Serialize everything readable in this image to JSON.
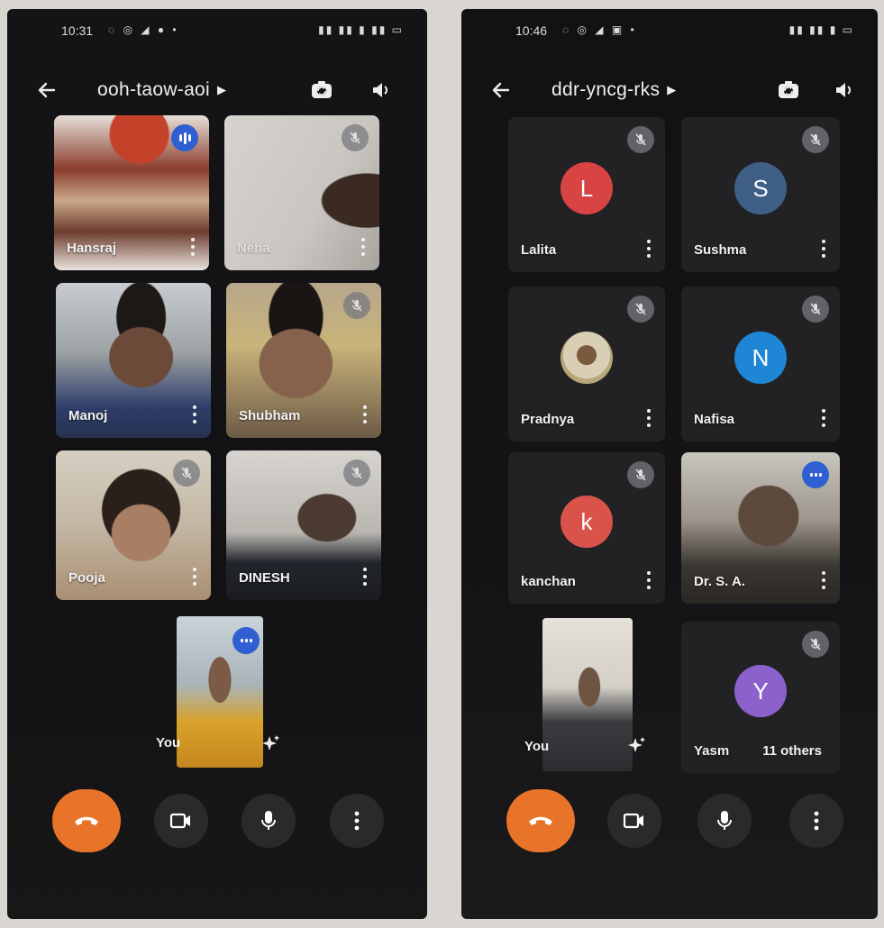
{
  "colors": {
    "end_call": "#e8742a",
    "talk_badge": "#2f5fd0"
  },
  "left_call": {
    "status_time": "10:31",
    "meeting_code": "ooh-taow-aoi",
    "participants": [
      {
        "name": "Hansraj"
      },
      {
        "name": "Neha"
      },
      {
        "name": "Manoj"
      },
      {
        "name": "Shubham"
      },
      {
        "name": "Pooja"
      },
      {
        "name": "DINESH"
      }
    ],
    "self_label": "You"
  },
  "right_call": {
    "status_time": "10:46",
    "meeting_code": "ddr-yncg-rks",
    "participants": [
      {
        "name": "Lalita",
        "initial": "L",
        "color": "#d84343"
      },
      {
        "name": "Sushma",
        "initial": "S",
        "color": "#3f5f86"
      },
      {
        "name": "Pradnya",
        "initial": "",
        "color": "#c9b98a"
      },
      {
        "name": "Nafisa",
        "initial": "N",
        "color": "#1f86d6"
      },
      {
        "name": "kanchan",
        "initial": "k",
        "color": "#d9534a"
      },
      {
        "name": "Dr. S. A.",
        "initial": "",
        "color": ""
      },
      {
        "name": "Yasm",
        "initial": "Y",
        "color": "#8b62cc"
      }
    ],
    "self_label": "You",
    "others_label": "11 others"
  },
  "icons": [
    "back-arrow-icon",
    "flip-camera-icon",
    "speaker-icon",
    "mic-off-icon",
    "more-vert-icon",
    "end-call-icon",
    "video-icon",
    "mic-icon",
    "sparkle-icon"
  ]
}
